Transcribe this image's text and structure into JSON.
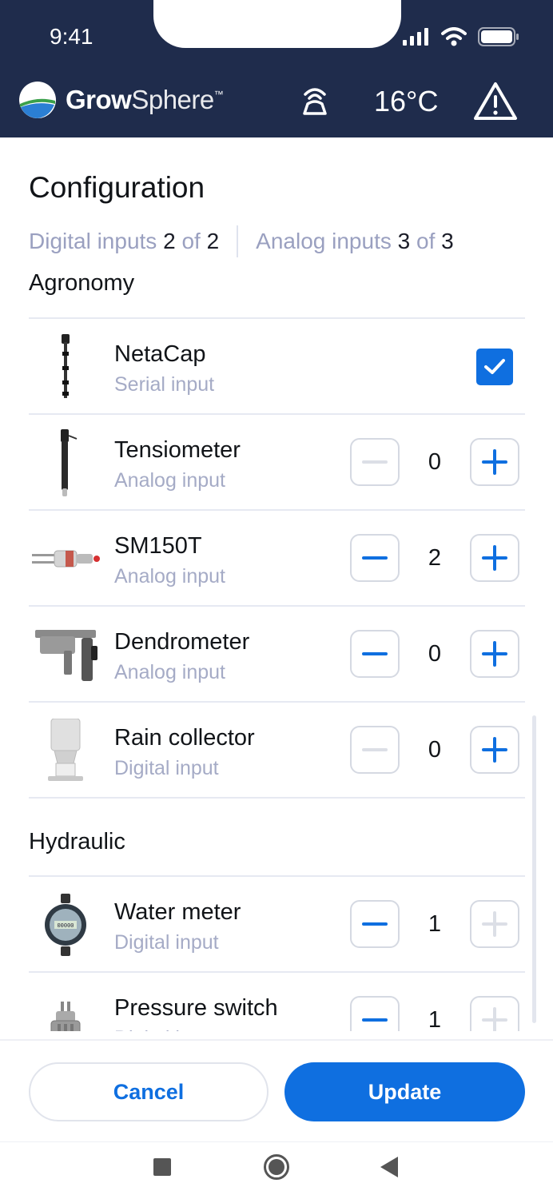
{
  "status_bar": {
    "time": "9:41"
  },
  "header": {
    "brand_bold": "Grow",
    "brand_light": "Sphere",
    "brand_tm": "™",
    "temperature": "16°C",
    "icons": {
      "signal": "signal-tower-icon",
      "warning": "warning-icon"
    },
    "colors": {
      "background": "#1f2c4c"
    }
  },
  "page": {
    "title": "Configuration",
    "digital_inputs": {
      "label": "Digital inputs",
      "used": "2",
      "of": "of",
      "total": "2"
    },
    "analog_inputs": {
      "label": "Analog inputs",
      "used": "3",
      "of": "of",
      "total": "3"
    }
  },
  "sections": {
    "agronomy": "Agronomy",
    "hydraulic": "Hydraulic"
  },
  "devices": {
    "netacap": {
      "name": "NetaCap",
      "type": "Serial input",
      "checked": true
    },
    "tensiometer": {
      "name": "Tensiometer",
      "type": "Analog input",
      "value": "0"
    },
    "sm150t": {
      "name": "SM150T",
      "type": "Analog input",
      "value": "2"
    },
    "dendrometer": {
      "name": "Dendrometer",
      "type": "Analog input",
      "value": "0"
    },
    "rain_collector": {
      "name": "Rain collector",
      "type": "Digital input",
      "value": "0"
    },
    "water_meter": {
      "name": "Water meter",
      "type": "Digital input",
      "value": "1"
    },
    "pressure_switch": {
      "name": "Pressure switch",
      "type": "Digital input",
      "value": "1"
    }
  },
  "actions": {
    "cancel": "Cancel",
    "update": "Update"
  },
  "colors": {
    "accent": "#0f6fe0",
    "muted_text": "#a5abc6",
    "divider": "#e6e9f2"
  }
}
